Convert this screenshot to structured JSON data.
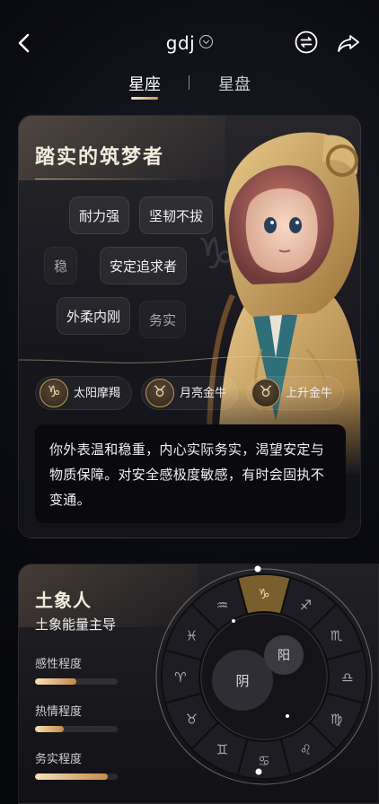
{
  "header": {
    "back_icon": "back-chevron-icon",
    "title": "gdj",
    "switch_icon": "switch-icon",
    "share_icon": "share-icon"
  },
  "tabs": [
    {
      "label": "星座",
      "active": true
    },
    {
      "label": "星盘",
      "active": false
    }
  ],
  "persona": {
    "title": "踏实的筑梦者",
    "tags": [
      "耐力强",
      "坚韧不拔",
      "稳",
      "安定追求者",
      "外柔内刚",
      "务实"
    ],
    "signs": [
      {
        "symbol": "♑",
        "label": "太阳摩羯"
      },
      {
        "symbol": "♉",
        "label": "月亮金牛"
      },
      {
        "symbol": "♉",
        "label": "上升金牛"
      }
    ],
    "description": "你外表温和稳重，内心实际务实，渴望安定与物质保障。对安全感极度敏感，有时会固执不变通。"
  },
  "element": {
    "title": "土象人",
    "subtitle": "土象能量主导",
    "metrics": [
      {
        "label": "感性程度",
        "level": 0.5
      },
      {
        "label": "热情程度",
        "level": 0.35
      },
      {
        "label": "务实程度",
        "level": 0.88
      }
    ],
    "wheel": {
      "yin_label": "阴",
      "yang_label": "阳",
      "highlight_sign": "♑",
      "signs": [
        "♑",
        "♐",
        "♏",
        "♎",
        "♍",
        "♌",
        "♋",
        "♊",
        "♉",
        "♈",
        "♓",
        "♒"
      ]
    }
  },
  "colors": {
    "accent_gold": "#c8975a",
    "background": "#0a0b10"
  }
}
